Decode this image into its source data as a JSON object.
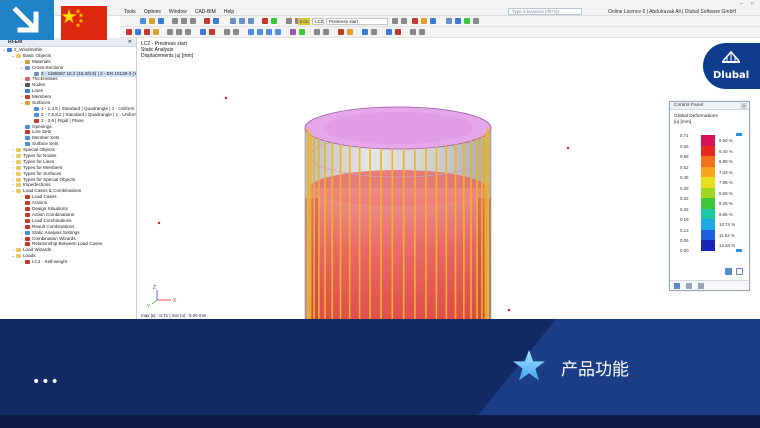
{
  "app": {
    "menu": [
      "Tools",
      "Options",
      "Window",
      "CAD-BIM",
      "Help"
    ],
    "licence": "Online Licence 6 | Abdulrazak Ali | Dlubal Software GmbH",
    "search_placeholder": "Type a keyword (Alt+Q)",
    "load_case_badge": "S Ch",
    "load_case_code": "LC2",
    "load_case_name": "Prestress start"
  },
  "navigator": {
    "title": "RFEM",
    "items": [
      {
        "level": 0,
        "exp": "v",
        "label": "2_Windmühle",
        "icon": "model-icon",
        "color": "#3a7bd5"
      },
      {
        "level": 1,
        "exp": "v",
        "label": "Basic Objects",
        "icon": "folder-icon",
        "color": "#e8c96a"
      },
      {
        "level": 2,
        "exp": ">",
        "label": "Materials",
        "icon": "material-icon",
        "color": "#c9a13a"
      },
      {
        "level": 2,
        "exp": "v",
        "label": "Cross-Sections",
        "icon": "section-icon",
        "color": "#6c8fc4"
      },
      {
        "level": 3,
        "exp": "",
        "label": "3 - 1168087 15.2 (15.2/0.6) | 3 - EN 10138-3 (Y1860)",
        "icon": "section-item-icon",
        "color": "#6c8fc4",
        "selected": true
      },
      {
        "level": 2,
        "exp": ">",
        "label": "Thicknesses",
        "icon": "thickness-icon",
        "color": "#d46a6a"
      },
      {
        "level": 2,
        "exp": ">",
        "label": "Nodes",
        "icon": "node-icon",
        "color": "#555555"
      },
      {
        "level": 2,
        "exp": ">",
        "label": "Lines",
        "icon": "line-icon",
        "color": "#3a7bd5"
      },
      {
        "level": 2,
        "exp": ">",
        "label": "Members",
        "icon": "member-icon",
        "color": "#c0392b"
      },
      {
        "level": 2,
        "exp": "v",
        "label": "Surfaces",
        "icon": "surface-icon",
        "color": "#e0a030"
      },
      {
        "level": 3,
        "exp": "",
        "label": "1 - 1,4,5 | Standard | Quadrangle | 1 - Uniform",
        "icon": "surface-item-icon",
        "color": "#4a90d9"
      },
      {
        "level": 3,
        "exp": "",
        "label": "2 - 7,6,8,2 | Standard | Quadrangle | 1 - Uniform",
        "icon": "surface-item-icon",
        "color": "#4a90d9"
      },
      {
        "level": 3,
        "exp": "",
        "label": "3 - 3,6 | Rigid | Plane",
        "icon": "surface-item-icon",
        "color": "#c0392b"
      },
      {
        "level": 2,
        "exp": "",
        "label": "Openings",
        "icon": "opening-icon",
        "color": "#4a90d9"
      },
      {
        "level": 2,
        "exp": "",
        "label": "Line Sets",
        "icon": "lineset-icon",
        "color": "#c0392b"
      },
      {
        "level": 2,
        "exp": "",
        "label": "Member Sets",
        "icon": "memberset-icon",
        "color": "#4a90d9"
      },
      {
        "level": 2,
        "exp": "",
        "label": "Surface Sets",
        "icon": "surfaceset-icon",
        "color": "#4a90d9"
      },
      {
        "level": 1,
        "exp": ">",
        "label": "Special Objects",
        "icon": "folder-icon",
        "color": "#e8c96a"
      },
      {
        "level": 1,
        "exp": ">",
        "label": "Types for Nodes",
        "icon": "folder-icon",
        "color": "#e8c96a"
      },
      {
        "level": 1,
        "exp": ">",
        "label": "Types for Lines",
        "icon": "folder-icon",
        "color": "#e8c96a"
      },
      {
        "level": 1,
        "exp": ">",
        "label": "Types for Members",
        "icon": "folder-icon",
        "color": "#e8c96a"
      },
      {
        "level": 1,
        "exp": ">",
        "label": "Types for Surfaces",
        "icon": "folder-icon",
        "color": "#e8c96a"
      },
      {
        "level": 1,
        "exp": ">",
        "label": "Types for Special Objects",
        "icon": "folder-icon",
        "color": "#e8c96a"
      },
      {
        "level": 1,
        "exp": ">",
        "label": "Imperfections",
        "icon": "folder-icon",
        "color": "#e8c96a"
      },
      {
        "level": 1,
        "exp": "v",
        "label": "Load Cases & Combinations",
        "icon": "folder-icon",
        "color": "#e8c96a"
      },
      {
        "level": 2,
        "exp": ">",
        "label": "Load Cases",
        "icon": "loadcase-icon",
        "color": "#c0392b"
      },
      {
        "level": 2,
        "exp": "",
        "label": "Actions",
        "icon": "action-icon",
        "color": "#c0392b"
      },
      {
        "level": 2,
        "exp": "",
        "label": "Design Situations",
        "icon": "design-situation-icon",
        "color": "#c0392b"
      },
      {
        "level": 2,
        "exp": "",
        "label": "Action Combinations",
        "icon": "combination-icon",
        "color": "#c0392b"
      },
      {
        "level": 2,
        "exp": "",
        "label": "Load Combinations",
        "icon": "combination-icon",
        "color": "#c0392b"
      },
      {
        "level": 2,
        "exp": ">",
        "label": "Result Combinations",
        "icon": "combination-icon",
        "color": "#c0392b"
      },
      {
        "level": 2,
        "exp": ">",
        "label": "Static Analysis Settings",
        "icon": "settings-icon",
        "color": "#4a90d9"
      },
      {
        "level": 2,
        "exp": ">",
        "label": "Combination Wizards",
        "icon": "wizard-icon",
        "color": "#c0392b"
      },
      {
        "level": 2,
        "exp": "",
        "label": "Relationship Between Load Cases",
        "icon": "relationship-icon",
        "color": "#c0392b"
      },
      {
        "level": 1,
        "exp": ">",
        "label": "Load Wizards",
        "icon": "folder-icon",
        "color": "#e8c96a"
      },
      {
        "level": 1,
        "exp": "v",
        "label": "Loads",
        "icon": "folder-icon",
        "color": "#e8c96a"
      },
      {
        "level": 2,
        "exp": ">",
        "label": "LC1 - Self-weight",
        "icon": "loadcase-icon",
        "color": "#c0392b"
      }
    ]
  },
  "viewport": {
    "info_line1": "LC2 - Prestress start",
    "info_line2": "Static Analysis",
    "info_line3": "Displacements |u| [mm]",
    "axis_x": "X",
    "axis_z": "Z",
    "axis_y": "Y",
    "bottom_note": "max |u| : 0.71 | min |u| : 0.00 mm"
  },
  "control_panel": {
    "title": "Control Panel",
    "heading": "Global Deformations",
    "unit": "|u| [mm]",
    "legend": [
      {
        "value": "0.71",
        "color": "#d4145a",
        "percent": "6.60 %"
      },
      {
        "value": "0.65",
        "color": "#e8271f",
        "percent": "6.40 %"
      },
      {
        "value": "0.58",
        "color": "#f2711b",
        "percent": "6.89 %"
      },
      {
        "value": "0.52",
        "color": "#f7a51c",
        "percent": "7.43 %"
      },
      {
        "value": "0.45",
        "color": "#e8e01c",
        "percent": "7.96 %"
      },
      {
        "value": "0.39",
        "color": "#9fd61e",
        "percent": "8.59 %"
      },
      {
        "value": "0.32",
        "color": "#3cc83a",
        "percent": "9.25 %"
      },
      {
        "value": "0.26",
        "color": "#1ec8a3",
        "percent": "9.86 %"
      },
      {
        "value": "0.19",
        "color": "#1ea9e0",
        "percent": "10.74 %"
      },
      {
        "value": "0.13",
        "color": "#1e5fe0",
        "percent": "11.62 %"
      },
      {
        "value": "0.06",
        "color": "#1a23b8",
        "percent": "12.53 %"
      }
    ],
    "last_value": "0.00"
  },
  "banner": {
    "dots": "•••",
    "feature_label": "产品功能"
  },
  "brand": {
    "name": "Dlubal",
    "accent": "#0f3c8c",
    "banner_color": "#1b3e86"
  },
  "flag": {
    "country": "China",
    "red": "#de2910",
    "yellow": "#ffde00"
  }
}
